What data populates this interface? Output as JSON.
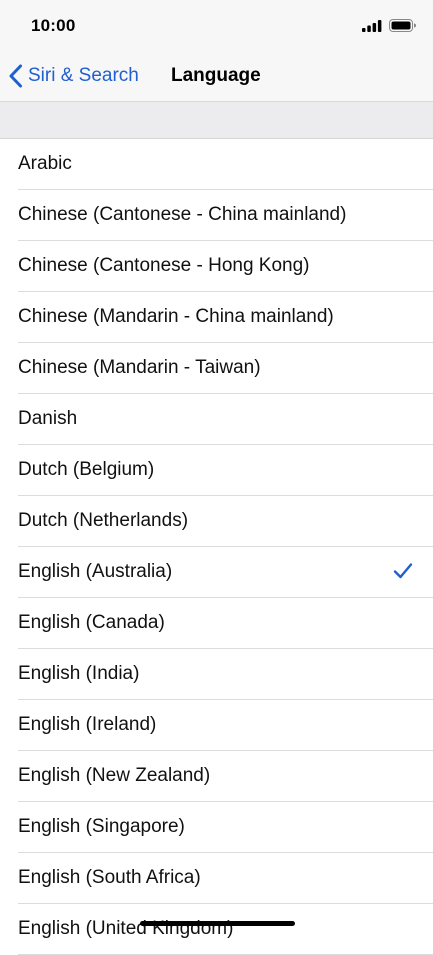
{
  "status_bar": {
    "time": "10:00"
  },
  "nav": {
    "back_label": "Siri & Search",
    "title": "Language"
  },
  "languages": [
    {
      "label": "Arabic",
      "selected": false
    },
    {
      "label": "Chinese (Cantonese - China mainland)",
      "selected": false
    },
    {
      "label": "Chinese (Cantonese - Hong Kong)",
      "selected": false
    },
    {
      "label": "Chinese (Mandarin - China mainland)",
      "selected": false
    },
    {
      "label": "Chinese (Mandarin - Taiwan)",
      "selected": false
    },
    {
      "label": "Danish",
      "selected": false
    },
    {
      "label": "Dutch (Belgium)",
      "selected": false
    },
    {
      "label": "Dutch (Netherlands)",
      "selected": false
    },
    {
      "label": "English (Australia)",
      "selected": true
    },
    {
      "label": "English (Canada)",
      "selected": false
    },
    {
      "label": "English (India)",
      "selected": false
    },
    {
      "label": "English (Ireland)",
      "selected": false
    },
    {
      "label": "English (New Zealand)",
      "selected": false
    },
    {
      "label": "English (Singapore)",
      "selected": false
    },
    {
      "label": "English (South Africa)",
      "selected": false
    },
    {
      "label": "English (United Kingdom)",
      "selected": false
    }
  ],
  "colors": {
    "accent": "#1f5fd0",
    "bar_background": "#f7f7f7",
    "group_background": "#ececef"
  },
  "icons": {
    "signal": "signal-bars-icon",
    "battery": "battery-icon",
    "back": "chevron-left-icon",
    "selected": "checkmark-icon"
  }
}
